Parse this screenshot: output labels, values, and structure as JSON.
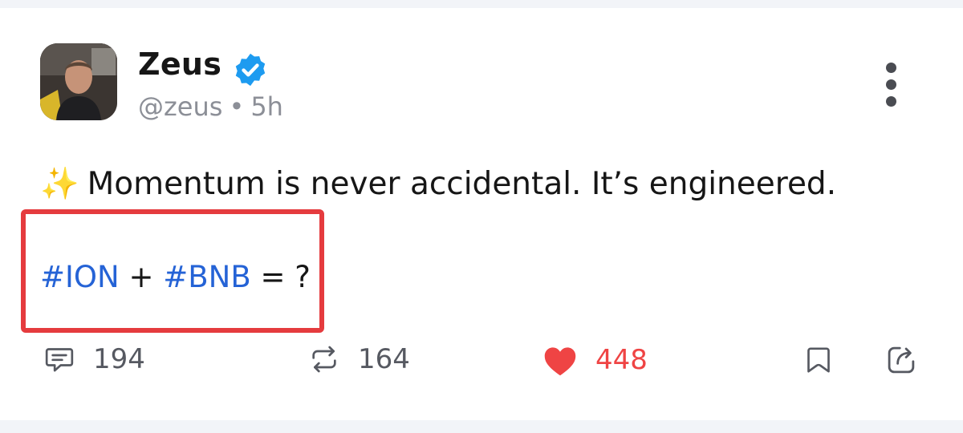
{
  "post": {
    "author": {
      "display_name": "Zeus",
      "handle": "@zeus",
      "separator": "•",
      "time_ago": "5h",
      "verified": true
    },
    "text": {
      "sparkle_emoji": "✨",
      "main": "Momentum is never accidental. It’s engineered.",
      "hashtag_1": "#ION",
      "plus": "+",
      "hashtag_2": "#BNB",
      "equals": "= ?"
    },
    "actions": {
      "replies": "194",
      "reposts": "164",
      "likes": "448"
    }
  },
  "colors": {
    "hashtag": "#2563d6",
    "like": "#ef4444",
    "highlight_border": "#e53b3e",
    "verified_badge": "#1d9bf0"
  },
  "icons": [
    "more-vertical-icon",
    "verified-badge-icon",
    "comment-icon",
    "repost-icon",
    "heart-icon",
    "bookmark-icon",
    "share-icon"
  ]
}
